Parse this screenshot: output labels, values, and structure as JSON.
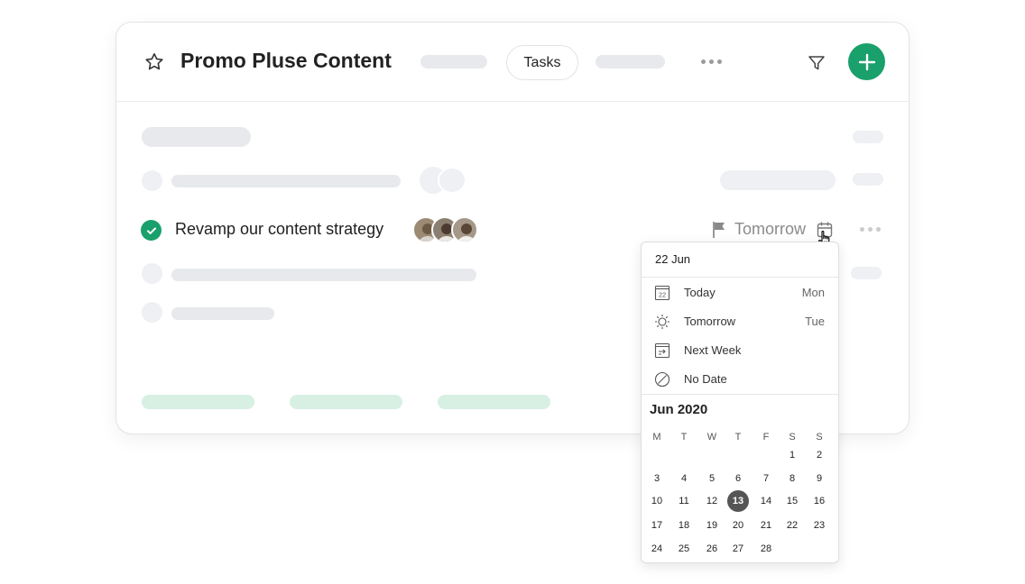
{
  "project": {
    "title": "Promo Pluse Content",
    "active_tab": "Tasks"
  },
  "task": {
    "text": "Revamp our content strategy",
    "completed": true,
    "due_label": "Tomorrow"
  },
  "date_picker": {
    "typed_date": "22 Jun",
    "options": [
      {
        "label": "Today",
        "day": "Mon",
        "icon": "calendar-today-icon"
      },
      {
        "label": "Tomorrow",
        "day": "Tue",
        "icon": "sun-icon"
      },
      {
        "label": "Next Week",
        "day": "",
        "icon": "next-week-icon"
      },
      {
        "label": "No Date",
        "day": "",
        "icon": "no-date-icon"
      }
    ],
    "today_icon_number": "22",
    "month_label": "Jun 2020",
    "weekdays": [
      "M",
      "T",
      "W",
      "T",
      "F",
      "S",
      "S"
    ],
    "weeks": [
      [
        "",
        "",
        "",
        "",
        "",
        "1",
        "2"
      ],
      [
        "3",
        "4",
        "5",
        "6",
        "7",
        "8",
        "9"
      ],
      [
        "10",
        "11",
        "12",
        "13",
        "14",
        "15",
        "16"
      ],
      [
        "17",
        "18",
        "19",
        "20",
        "21",
        "22",
        "23"
      ],
      [
        "24",
        "25",
        "26",
        "27",
        "28",
        "",
        ""
      ]
    ],
    "selected_day": "13"
  },
  "colors": {
    "accent_green": "#1aa06b",
    "placeholder_gray": "#e7e9ec",
    "placeholder_green": "#d7f0e3",
    "selected_day_bg": "#555555"
  }
}
